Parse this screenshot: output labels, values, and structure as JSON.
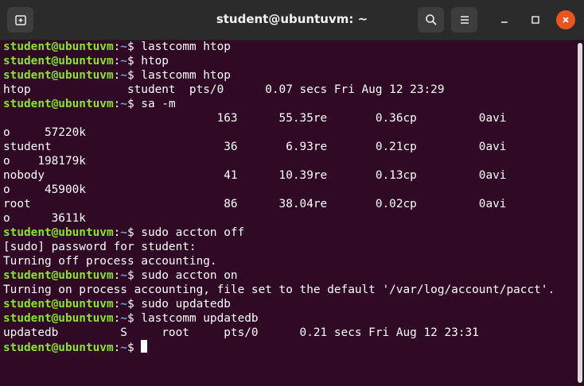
{
  "window": {
    "title": "student@ubuntuvm: ~"
  },
  "icons": {
    "new_tab": "new-tab-icon",
    "search": "search-icon",
    "menu": "hamburger-menu-icon",
    "minimize": "minimize-icon",
    "maximize": "maximize-icon",
    "close": "close-icon"
  },
  "colors": {
    "terminal_bg": "#300a24",
    "prompt_green": "#8ae234",
    "path_blue": "#729fcf",
    "close_orange": "#e95420"
  },
  "terminal": {
    "prompt_user": "student@ubuntuvm",
    "prompt_path": "~",
    "lines": [
      {
        "type": "cmd",
        "text": "lastcomm htop"
      },
      {
        "type": "cmd",
        "text": "htop"
      },
      {
        "type": "cmd",
        "text": "lastcomm htop"
      },
      {
        "type": "out",
        "text": "htop              student  pts/0      0.07 secs Fri Aug 12 23:29"
      },
      {
        "type": "cmd",
        "text": "sa -m"
      },
      {
        "type": "out",
        "text": "                               163      55.35re       0.36cp         0avi"
      },
      {
        "type": "out",
        "text": "o     57220k"
      },
      {
        "type": "out",
        "text": "student                         36       6.93re       0.21cp         0avi"
      },
      {
        "type": "out",
        "text": "o    198179k"
      },
      {
        "type": "out",
        "text": "nobody                          41      10.39re       0.13cp         0avi"
      },
      {
        "type": "out",
        "text": "o     45900k"
      },
      {
        "type": "out",
        "text": "root                            86      38.04re       0.02cp         0avi"
      },
      {
        "type": "out",
        "text": "o      3611k"
      },
      {
        "type": "cmd",
        "text": "sudo accton off"
      },
      {
        "type": "out",
        "text": "[sudo] password for student:"
      },
      {
        "type": "out",
        "text": "Turning off process accounting."
      },
      {
        "type": "cmd",
        "text": "sudo accton on"
      },
      {
        "type": "out",
        "text": "Turning on process accounting, file set to the default '/var/log/account/pacct'."
      },
      {
        "type": "cmd",
        "text": "sudo updatedb"
      },
      {
        "type": "cmd",
        "text": "lastcomm updatedb"
      },
      {
        "type": "out",
        "text": "updatedb         S     root     pts/0      0.21 secs Fri Aug 12 23:31"
      },
      {
        "type": "cmd",
        "text": ""
      }
    ]
  }
}
